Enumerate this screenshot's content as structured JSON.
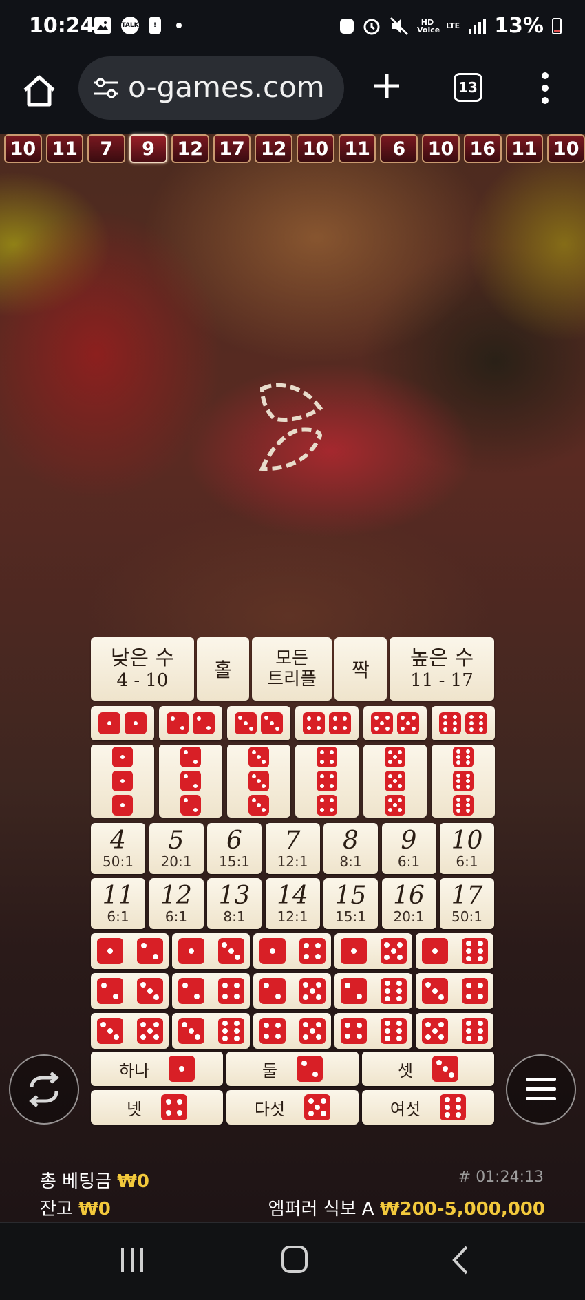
{
  "status_bar": {
    "time": "10:24",
    "battery": "13%",
    "talk": "TALK",
    "hd_voice": "HD Voice",
    "lte": "LTE"
  },
  "browser": {
    "url": "o-games.com",
    "tab_count": "13"
  },
  "history": [
    "10",
    "11",
    "7",
    "9",
    "12",
    "17",
    "12",
    "10",
    "11",
    "6",
    "10",
    "16",
    "11",
    "10"
  ],
  "history_active_index": 3,
  "board": {
    "low": {
      "title": "낮은 수",
      "range": "4 - 10"
    },
    "odd": {
      "title": "홀"
    },
    "any_triple": {
      "line1": "모든",
      "line2": "트리플"
    },
    "even": {
      "title": "짝"
    },
    "high": {
      "title": "높은 수",
      "range": "11 - 17"
    },
    "doubles": [
      1,
      2,
      3,
      4,
      5,
      6
    ],
    "triples": [
      1,
      2,
      3,
      4,
      5,
      6
    ],
    "totals_row1": [
      {
        "total": "4",
        "odds": "50:1"
      },
      {
        "total": "5",
        "odds": "20:1"
      },
      {
        "total": "6",
        "odds": "15:1"
      },
      {
        "total": "7",
        "odds": "12:1"
      },
      {
        "total": "8",
        "odds": "8:1"
      },
      {
        "total": "9",
        "odds": "6:1"
      },
      {
        "total": "10",
        "odds": "6:1"
      }
    ],
    "totals_row2": [
      {
        "total": "11",
        "odds": "6:1"
      },
      {
        "total": "12",
        "odds": "6:1"
      },
      {
        "total": "13",
        "odds": "8:1"
      },
      {
        "total": "14",
        "odds": "12:1"
      },
      {
        "total": "15",
        "odds": "15:1"
      },
      {
        "total": "16",
        "odds": "20:1"
      },
      {
        "total": "17",
        "odds": "50:1"
      }
    ],
    "combos": [
      [
        [
          1,
          2
        ],
        [
          1,
          3
        ],
        [
          1,
          4
        ],
        [
          1,
          5
        ],
        [
          1,
          6
        ]
      ],
      [
        [
          2,
          3
        ],
        [
          2,
          4
        ],
        [
          2,
          5
        ],
        [
          2,
          6
        ],
        [
          3,
          4
        ]
      ],
      [
        [
          3,
          5
        ],
        [
          3,
          6
        ],
        [
          4,
          5
        ],
        [
          4,
          6
        ],
        [
          5,
          6
        ]
      ]
    ],
    "singles": [
      {
        "label": "하나",
        "face": 1
      },
      {
        "label": "둘",
        "face": 2
      },
      {
        "label": "셋",
        "face": 3
      },
      {
        "label": "넷",
        "face": 4
      },
      {
        "label": "다섯",
        "face": 5
      },
      {
        "label": "여섯",
        "face": 6
      }
    ]
  },
  "footer": {
    "total_bet_label": "총 베팅금",
    "total_bet_value": "₩0",
    "balance_label": "잔고",
    "balance_value": "₩0",
    "round_id": "# 01:24:13",
    "table_name": "엠퍼러 식보 A",
    "limits": "₩200-5,000,000"
  },
  "colors": {
    "die_red": "#d81f26",
    "gold": "#f3c93c",
    "tile": "#fbf6ea"
  }
}
